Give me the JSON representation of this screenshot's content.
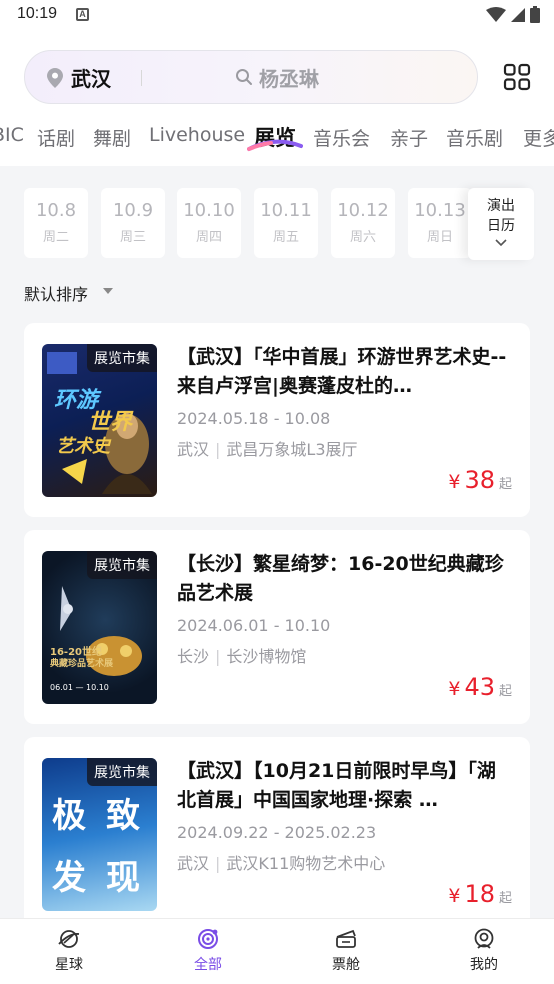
{
  "status": {
    "time": "10:19",
    "notif_letter": "A"
  },
  "search": {
    "city": "武汉",
    "query": "杨丞琳"
  },
  "categories": [
    {
      "label": "BIC"
    },
    {
      "label": "话剧"
    },
    {
      "label": "舞剧"
    },
    {
      "label": "Livehouse"
    },
    {
      "label": "展览"
    },
    {
      "label": "音乐会"
    },
    {
      "label": "亲子"
    },
    {
      "label": "音乐剧"
    },
    {
      "label": "更多"
    }
  ],
  "active_category": "展览",
  "dates": [
    {
      "day": "10.8",
      "weekday": "周二"
    },
    {
      "day": "10.9",
      "weekday": "周三"
    },
    {
      "day": "10.10",
      "weekday": "周四"
    },
    {
      "day": "10.11",
      "weekday": "周五"
    },
    {
      "day": "10.12",
      "weekday": "周六"
    },
    {
      "day": "10.13",
      "weekday": "周日"
    }
  ],
  "calendar_button": {
    "line1": "演出",
    "line2": "日历"
  },
  "sort_label": "默认排序",
  "cards": [
    {
      "tag": "展览市集",
      "title": "【武汉】「华中首展」环游世界艺术史--来自卢浮宫|奥赛蓬皮杜的…",
      "date": "2024.05.18 - 10.08",
      "city": "武汉",
      "venue": "武昌万象城L3展厅",
      "price_symbol": "¥",
      "price": "38",
      "price_suffix": "起",
      "poster_text": [
        "环游",
        "世界",
        "艺术史"
      ]
    },
    {
      "tag": "展览市集",
      "title": "【长沙】繁星绮梦：16-20世纪典藏珍品艺术展",
      "date": "2024.06.01 - 10.10",
      "city": "长沙",
      "venue": "长沙博物馆",
      "price_symbol": "¥",
      "price": "43",
      "price_suffix": "起",
      "poster_text": [
        "16-20世纪",
        "典藏珍品艺术展",
        "06.01 — 10.10"
      ]
    },
    {
      "tag": "展览市集",
      "title": "【武汉】【10月21日前限时早鸟】「湖北首展」中国国家地理·探索 …",
      "date": "2024.09.22 - 2025.02.23",
      "city": "武汉",
      "venue": "武汉K11购物艺术中心",
      "price_symbol": "¥",
      "price": "18",
      "price_suffix": "起",
      "poster_text": [
        "极",
        "致",
        "发",
        "现"
      ]
    }
  ],
  "tabs": [
    {
      "label": "星球",
      "icon": "planet-icon"
    },
    {
      "label": "全部",
      "icon": "all-icon"
    },
    {
      "label": "票舱",
      "icon": "ticket-icon"
    },
    {
      "label": "我的",
      "icon": "profile-icon"
    }
  ],
  "active_tab": "全部",
  "colors": {
    "accent": "#7a4de6",
    "price": "#e8202c",
    "background": "#f4f5f7"
  }
}
